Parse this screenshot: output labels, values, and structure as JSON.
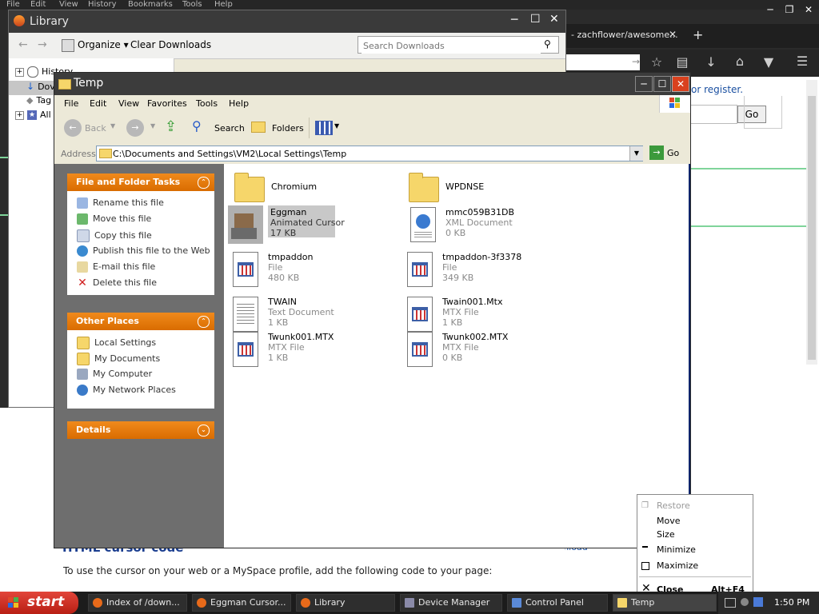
{
  "browser": {
    "menubar": [
      "File",
      "Edit",
      "View",
      "History",
      "Bookmarks",
      "Tools",
      "Help"
    ],
    "tab_title": "- zachflower/awesome...",
    "page_text_register": "or register.",
    "go_button": "Go",
    "heading": "HTML cursor code",
    "page_text": "To use the cursor on your web or a MySpace profile, add the following code to your page:",
    "download_link": "Download"
  },
  "library": {
    "title": "Library",
    "organize_label": "Organize",
    "clear_downloads_label": "Clear Downloads",
    "search_placeholder": "Search Downloads",
    "tree": [
      {
        "label": "History"
      },
      {
        "label": "Dov"
      },
      {
        "label": "Tag"
      },
      {
        "label": "All t"
      }
    ]
  },
  "explorer": {
    "title": "Temp",
    "menus": [
      "File",
      "Edit",
      "View",
      "Favorites",
      "Tools",
      "Help"
    ],
    "toolbar": {
      "back": "Back",
      "search": "Search",
      "folders": "Folders"
    },
    "address_label": "Address",
    "address_value": "C:\\Documents and Settings\\VM2\\Local Settings\\Temp",
    "go_label": "Go",
    "file_tasks": {
      "title": "File and Folder Tasks",
      "items": [
        "Rename this file",
        "Move this file",
        "Copy this file",
        "Publish this file to the Web",
        "E-mail this file",
        "Delete this file"
      ]
    },
    "other_places": {
      "title": "Other Places",
      "items": [
        "Local Settings",
        "My Documents",
        "My Computer",
        "My Network Places"
      ]
    },
    "details": {
      "title": "Details"
    },
    "files": [
      {
        "name": "Chromium",
        "type": "",
        "size": "",
        "icon": "folder"
      },
      {
        "name": "WPDNSE",
        "type": "",
        "size": "",
        "icon": "folder"
      },
      {
        "name": "Eggman",
        "type": "Animated Cursor",
        "size": "17 KB",
        "icon": "cursor"
      },
      {
        "name": "mmc059B31DB",
        "type": "XML Document",
        "size": "0 KB",
        "icon": "xml"
      },
      {
        "name": "tmpaddon",
        "type": "File",
        "size": "480 KB",
        "icon": "file"
      },
      {
        "name": "tmpaddon-3f3378",
        "type": "File",
        "size": "349 KB",
        "icon": "file"
      },
      {
        "name": "TWAIN",
        "type": "Text Document",
        "size": "1 KB",
        "icon": "text"
      },
      {
        "name": "Twain001.Mtx",
        "type": "MTX File",
        "size": "1 KB",
        "icon": "file"
      },
      {
        "name": "Twunk001.MTX",
        "type": "MTX File",
        "size": "1 KB",
        "icon": "file"
      },
      {
        "name": "Twunk002.MTX",
        "type": "MTX File",
        "size": "0 KB",
        "icon": "file"
      }
    ]
  },
  "context_menu": {
    "items": [
      {
        "label": "Restore",
        "enabled": false
      },
      {
        "label": "Move",
        "enabled": true
      },
      {
        "label": "Size",
        "enabled": true
      },
      {
        "label": "Minimize",
        "enabled": true
      },
      {
        "label": "Maximize",
        "enabled": true
      },
      {
        "label": "Close",
        "shortcut": "Alt+F4",
        "enabled": true
      }
    ]
  },
  "taskbar": {
    "start_label": "start",
    "buttons": [
      "Index of /down...",
      "Eggman Cursor...",
      "Library",
      "Device Manager",
      "Control Panel",
      "Temp"
    ],
    "clock": "1:50 PM"
  },
  "colors": {
    "xp_orange": "#e87a14",
    "xp_blue": "#0a246a",
    "start_red": "#cf3023",
    "highlight": "#b8b8b8"
  }
}
